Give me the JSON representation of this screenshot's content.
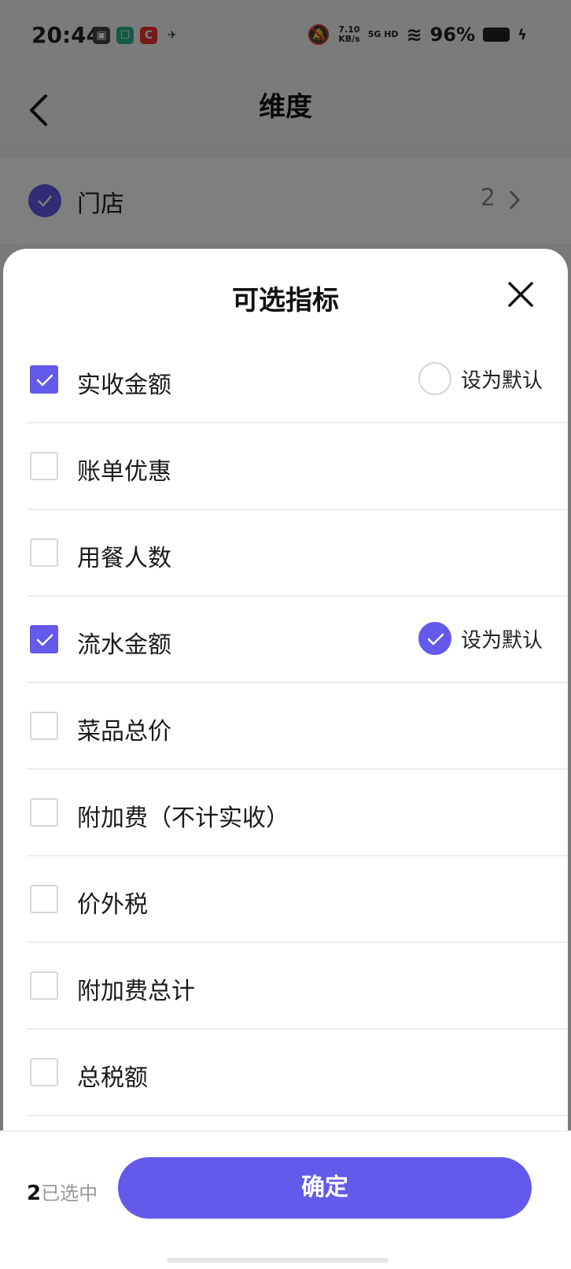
{
  "status_bar": {
    "time": "20:44",
    "net_speed_top": "7.10",
    "net_speed_bottom": "KB/s",
    "network": "5G HD",
    "battery": "96%"
  },
  "header": {
    "title": "维度"
  },
  "dimension": {
    "label": "门店",
    "count": "2"
  },
  "sheet": {
    "title": "可选指标",
    "items": [
      {
        "label": "实收金额",
        "checked": true,
        "show_default": true,
        "is_default": false
      },
      {
        "label": "账单优惠",
        "checked": false,
        "show_default": false,
        "is_default": false
      },
      {
        "label": "用餐人数",
        "checked": false,
        "show_default": false,
        "is_default": false
      },
      {
        "label": "流水金额",
        "checked": true,
        "show_default": true,
        "is_default": true
      },
      {
        "label": "菜品总价",
        "checked": false,
        "show_default": false,
        "is_default": false
      },
      {
        "label": "附加费（不计实收）",
        "checked": false,
        "show_default": false,
        "is_default": false
      },
      {
        "label": "价外税",
        "checked": false,
        "show_default": false,
        "is_default": false
      },
      {
        "label": "附加费总计",
        "checked": false,
        "show_default": false,
        "is_default": false
      },
      {
        "label": "总税额",
        "checked": false,
        "show_default": false,
        "is_default": false
      }
    ],
    "default_label": "设为默认"
  },
  "footer": {
    "selected_count": "2",
    "selected_label": "已选中",
    "confirm_label": "确定"
  },
  "colors": {
    "accent": "#6359ea",
    "divider": "#ececec"
  }
}
